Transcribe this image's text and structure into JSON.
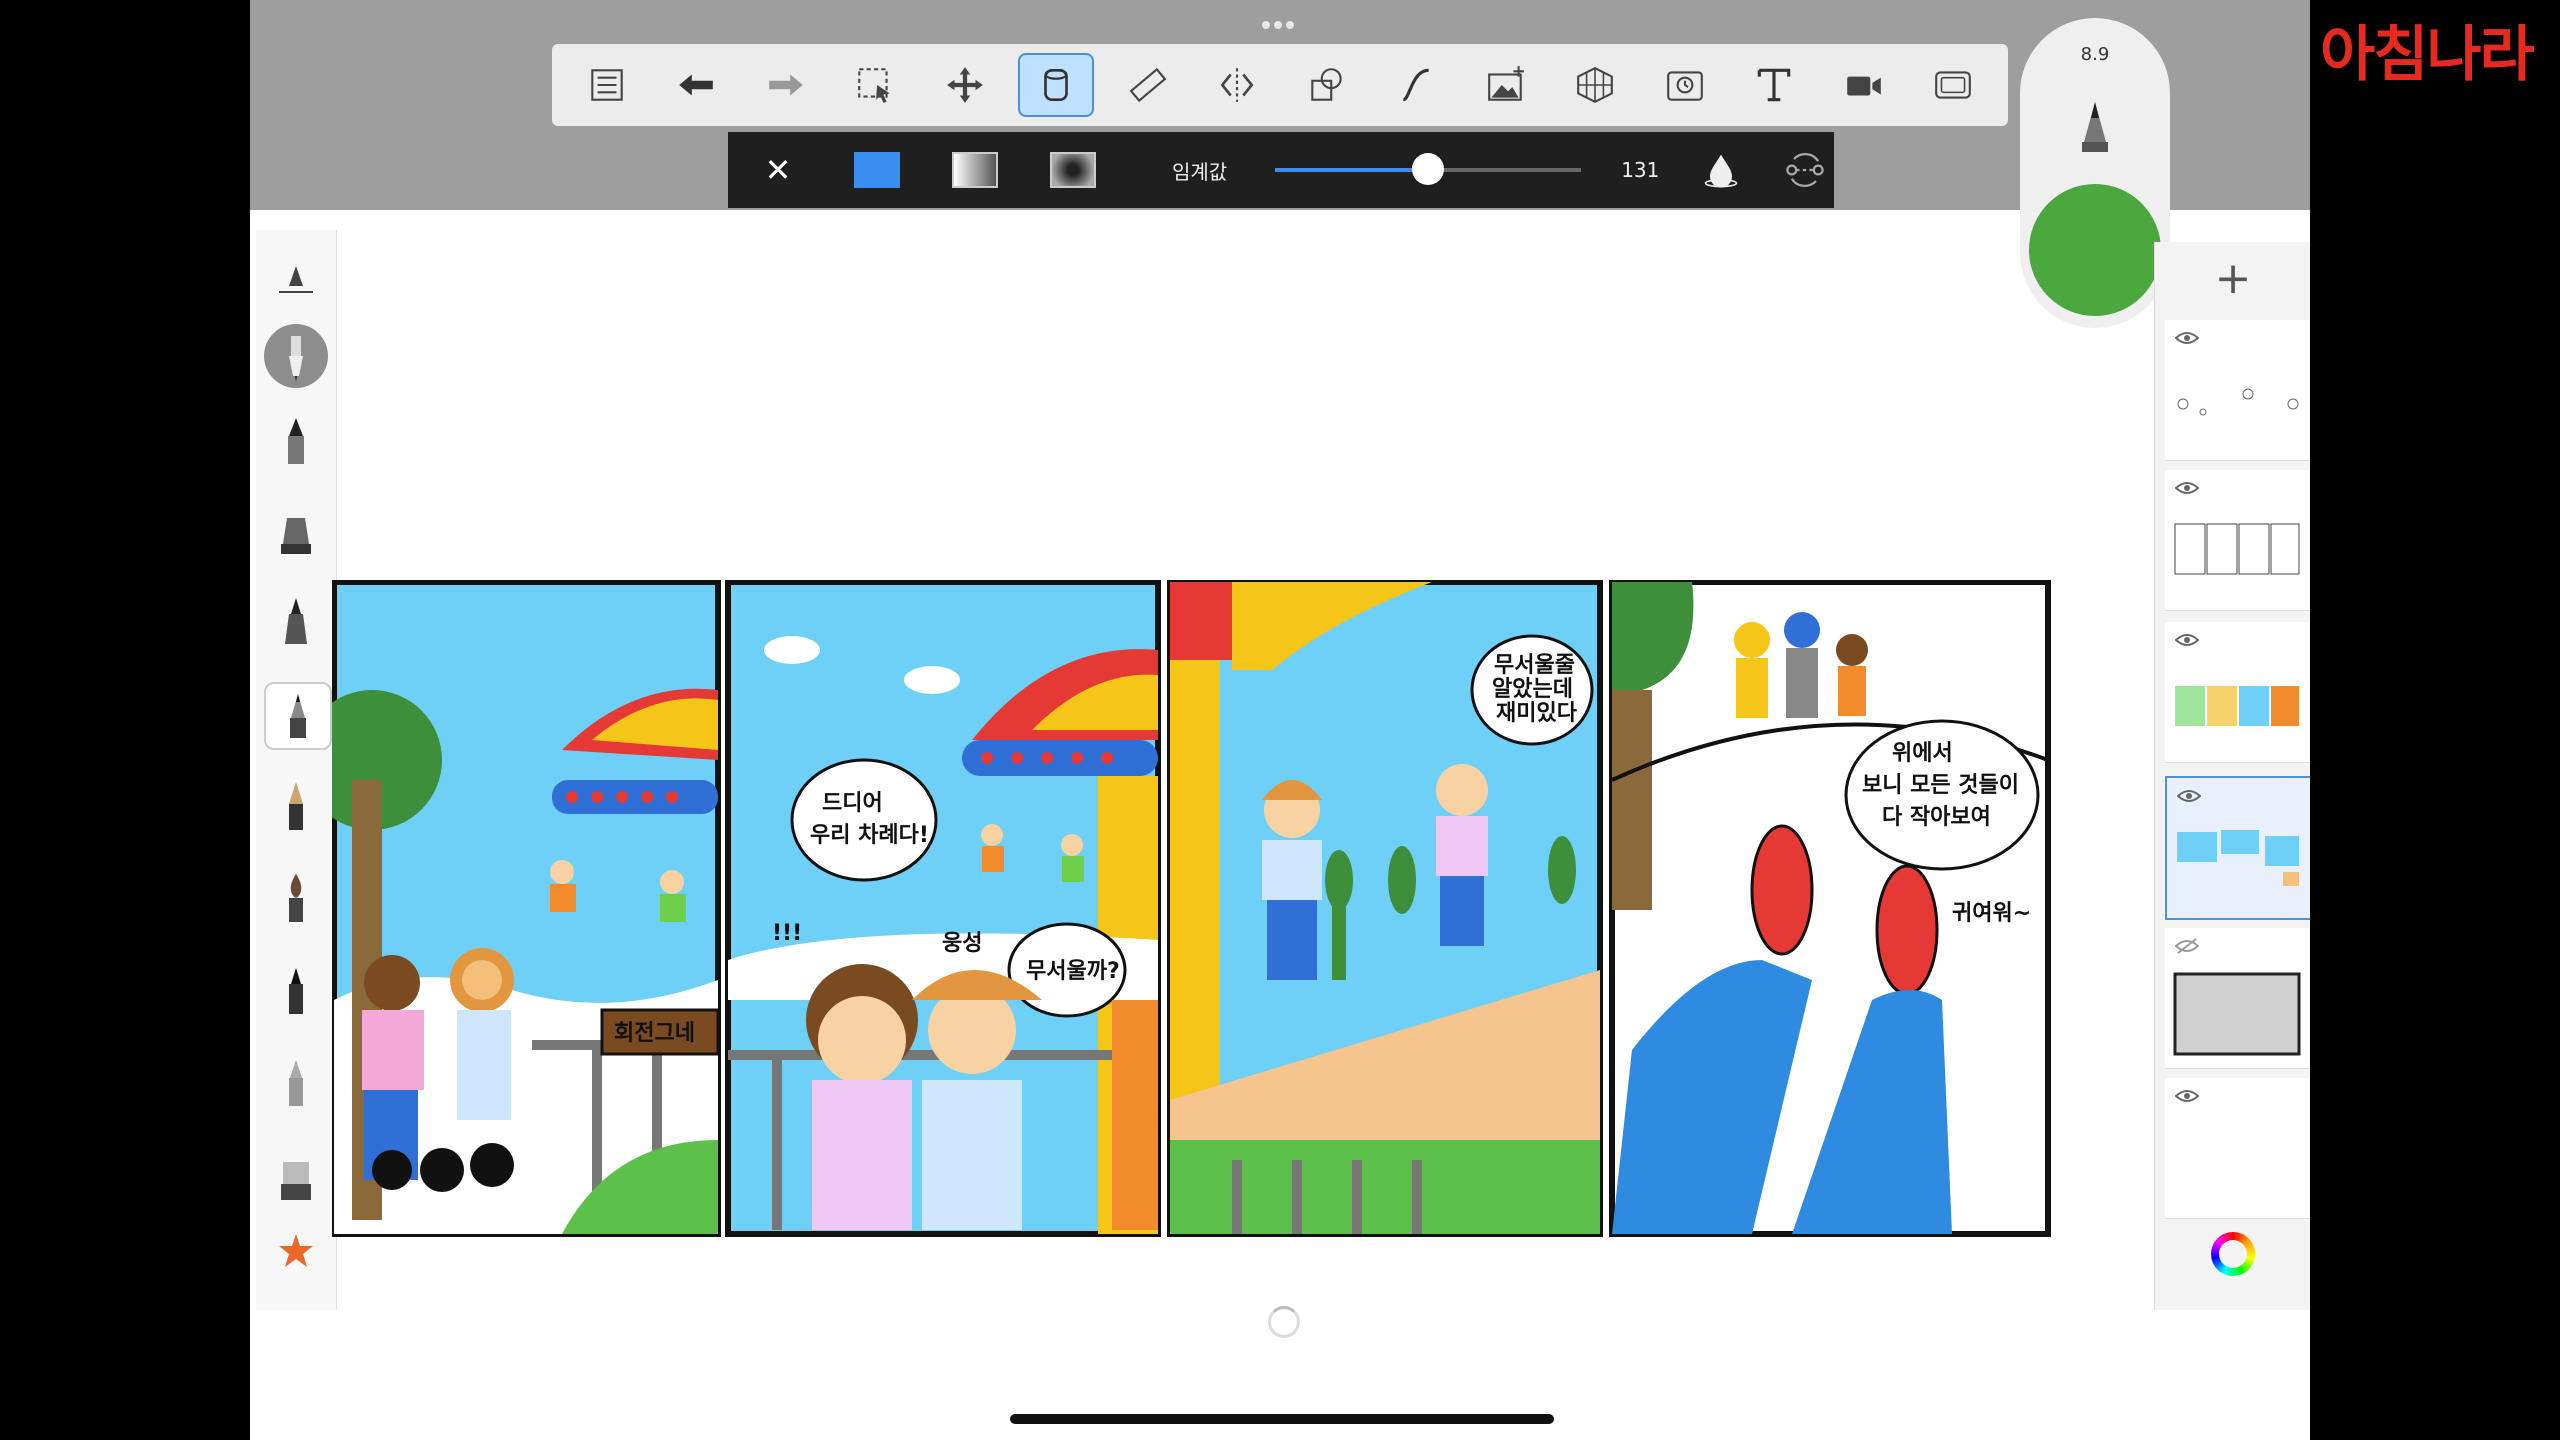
{
  "watermark": {
    "text": "아침나라",
    "color": "#e62a1f"
  },
  "toolbar": {
    "items": [
      {
        "name": "layers-list",
        "icon": "list-icon"
      },
      {
        "name": "undo",
        "icon": "undo-icon"
      },
      {
        "name": "redo",
        "icon": "redo-icon"
      },
      {
        "name": "selection",
        "icon": "selection-icon"
      },
      {
        "name": "transform",
        "icon": "move-icon"
      },
      {
        "name": "fill",
        "icon": "paint-bucket-icon",
        "active": true
      },
      {
        "name": "ruler",
        "icon": "ruler-icon"
      },
      {
        "name": "symmetry",
        "icon": "symmetry-icon"
      },
      {
        "name": "shapes",
        "icon": "shapes-icon"
      },
      {
        "name": "stroke",
        "icon": "curve-icon"
      },
      {
        "name": "image",
        "icon": "image-add-icon"
      },
      {
        "name": "perspective",
        "icon": "perspective-grid-icon"
      },
      {
        "name": "time-lapse",
        "icon": "timelapse-icon"
      },
      {
        "name": "text",
        "icon": "text-icon"
      },
      {
        "name": "video",
        "icon": "video-icon"
      },
      {
        "name": "fullscreen",
        "icon": "fullscreen-icon"
      }
    ]
  },
  "fill_bar": {
    "close_label": "✕",
    "threshold_label": "임계값",
    "threshold_value": "131",
    "threshold_fraction": 0.5,
    "accent": "#3a8ef0"
  },
  "brush": {
    "size": "8.9",
    "color": "#4aa83f"
  },
  "layers": {
    "add_label": "+",
    "selected_index": 3
  },
  "comic": {
    "panel1": {
      "sign": "회전그네"
    },
    "panel2": {
      "bubble1_line1": "드디어",
      "bubble1_line2": "우리 차례다!",
      "bubble2": "무서울까?",
      "exclaim": "!!!",
      "sound": "웅성"
    },
    "panel3": {
      "bubble_line1": "무서울줄",
      "bubble_line2": "알았는데",
      "bubble_line3": "재미있다"
    },
    "panel4": {
      "bubble_line1": "위에서",
      "bubble_line2": "보니 모든 것들이",
      "bubble_line3": "다 작아보여",
      "caption": "귀여워~"
    }
  }
}
